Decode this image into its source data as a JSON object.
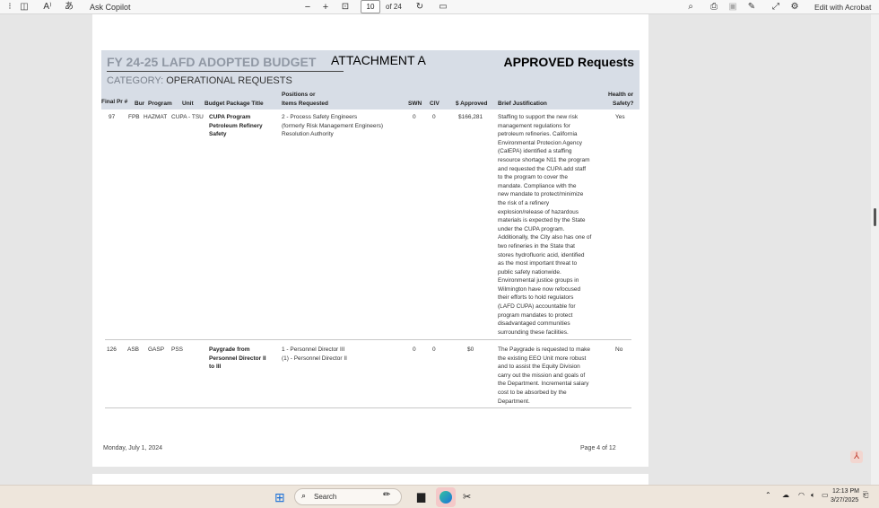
{
  "toolbar": {
    "ask_copilot": "Ask Copilot",
    "zoom_out": "−",
    "zoom_in": "+",
    "page_number": "10",
    "page_total": "of 24",
    "edit_acrobat": "Edit with Acrobat"
  },
  "document": {
    "header": {
      "budget_title": "FY 24-25 LAFD ADOPTED BUDGET",
      "attachment": "ATTACHMENT A",
      "approved": "APPROVED Requests",
      "category_label": "CATEGORY:",
      "category_value": "OPERATIONAL REQUESTS"
    },
    "columns": {
      "final_pr": "Final Pr #",
      "bur": "Bur",
      "program": "Program",
      "unit": "Unit",
      "budget_package": "Budget Package Title",
      "positions_1": "Positions or",
      "positions_2": "Items Requested",
      "swn": "SWN",
      "civ": "CIV",
      "approved": "$ Approved",
      "justification": "Brief Justification",
      "health_1": "Health or",
      "health_2": "Safety?"
    },
    "rows": [
      {
        "final_pr": "97",
        "bur": "FPB",
        "program": "HAZMAT",
        "unit": "CUPA - TSU",
        "title_lines": [
          "CUPA Program",
          "Petroleum Refinery",
          "Safety"
        ],
        "position_lines": [
          "2 - Process Safety Engineers",
          "(formerly Risk Management Engineers)",
          "Resolution Authority"
        ],
        "swn": "0",
        "civ": "0",
        "approved": "$166,281",
        "justification_lines": [
          "Staffing to support the new risk",
          "management regulations for",
          "petroleum refineries.  California",
          "Environmental Protecion Agency",
          "(CalEPA) identified a staffing",
          "resource shortage N11 the program",
          "and requested the CUPA add staff",
          "to the program to cover the",
          "mandate.   Compliance with the",
          "new mandate to protect/minimize",
          "the risk of a refinery",
          "explosion/release of hazardous",
          "materials is expected by the State",
          "under the CUPA program.",
          "Additionally, the City also has one of",
          "two refineries in the State that",
          "stores hydrofluoric acid, identified",
          "as the most important threat to",
          "public safety nationwide.",
          "Environmental justice groups in",
          "Wilmington have now refocused",
          "their efforts to hold regulators",
          "(LAFD CUPA) accountable for",
          "program mandates to protect",
          "disadvantaged communities",
          "surrounding these facilities."
        ],
        "health_safety": "Yes"
      },
      {
        "final_pr": "126",
        "bur": "ASB",
        "program": "GASP",
        "unit": "PSS",
        "title_lines": [
          "Paygrade from",
          "Personnel Director II",
          "to III"
        ],
        "position_lines": [
          "1 - Personnel Director III",
          "(1) - Personnel Director II"
        ],
        "swn": "0",
        "civ": "0",
        "approved": "$0",
        "justification_lines": [
          "The Paygrade is requested to make",
          "the existing EEO Unit more robust",
          "and to assist the Equity Division",
          "carry out the mission and goals of",
          "the Department.  Incremental salary",
          "cost to be absorbed by the",
          "Department."
        ],
        "health_safety": "No"
      }
    ],
    "footer": {
      "date": "Monday, July 1, 2024",
      "page": "Page 4 of 12"
    }
  },
  "taskbar": {
    "search_placeholder": "Search",
    "time": "12:13 PM",
    "date": "3/27/2025"
  },
  "icons": [
    "sidebar-icon",
    "read-aloud-icon",
    "translate-icon",
    "search-icon",
    "fit-page-icon",
    "rotate-icon",
    "two-page-icon",
    "print-icon",
    "save-icon",
    "draw-icon",
    "fullscreen-icon",
    "settings-icon",
    "windows-start-icon",
    "edge-icon",
    "snip-icon",
    "wifi-icon",
    "volume-icon",
    "battery-icon"
  ]
}
